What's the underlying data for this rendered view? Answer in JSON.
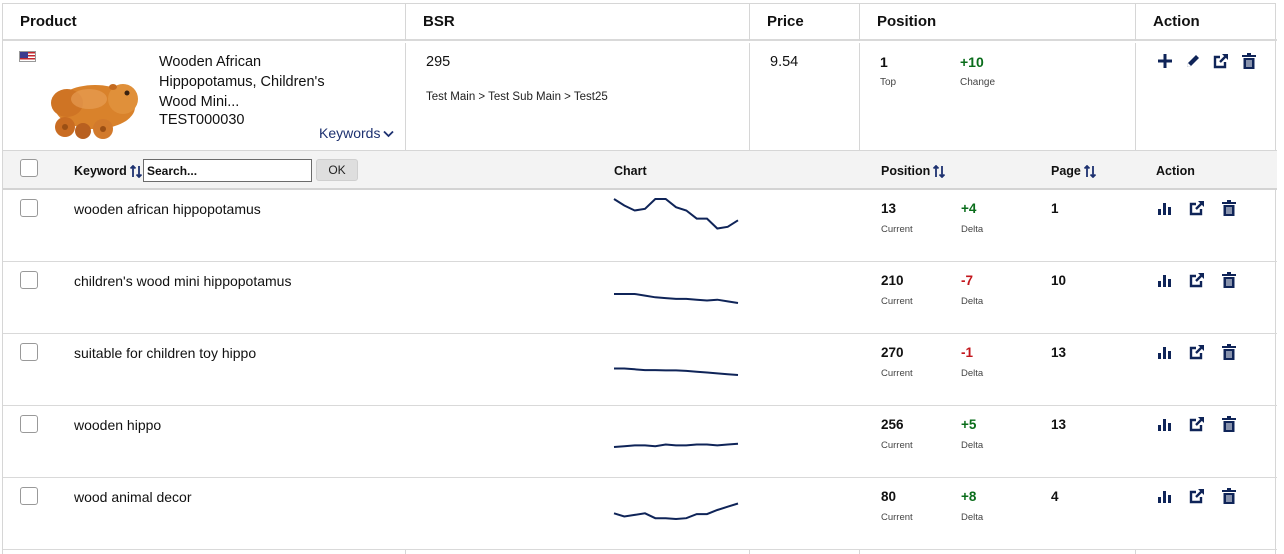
{
  "header": {
    "product": "Product",
    "bsr": "BSR",
    "price": "Price",
    "position": "Position",
    "action": "Action"
  },
  "product": {
    "flag": "us-flag-icon",
    "title": "Wooden African Hippopotamus, Children's Wood Mini...",
    "sku": "TEST000030",
    "keywords_link": "Keywords",
    "bsr": "295",
    "category_path": "Test Main > Test Sub Main > Test25",
    "price": "9.54",
    "position": {
      "value": "1",
      "label": "Top",
      "change": "+10",
      "change_label": "Change"
    },
    "actions": [
      "plus-icon",
      "pencil-icon",
      "external-link-icon",
      "trash-icon"
    ]
  },
  "keyword_table": {
    "keyword_header": "Keyword",
    "search_placeholder": "Search...",
    "ok_label": "OK",
    "chart_header": "Chart",
    "position_header": "Position",
    "page_header": "Page",
    "action_header": "Action",
    "current_label": "Current",
    "delta_label": "Delta",
    "row_actions": [
      "bar-chart-icon",
      "external-link-icon",
      "trash-icon"
    ],
    "spark_color": "#0f2458",
    "rows": [
      {
        "keyword": "wooden african hippopotamus",
        "current": "13",
        "delta": "+4",
        "delta_sign": "pos",
        "page": "1",
        "trend": [
          2,
          6,
          9,
          8,
          2,
          2,
          7,
          9,
          14,
          14,
          20,
          19,
          15
        ]
      },
      {
        "keyword": "children's wood mini hippopotamus",
        "current": "210",
        "delta": "-7",
        "delta_sign": "neg",
        "page": "10",
        "trend": [
          208,
          208,
          208,
          209,
          210,
          210.5,
          211,
          211,
          211.5,
          212,
          211.5,
          212.5,
          213.5
        ]
      },
      {
        "keyword": "suitable for children toy hippo",
        "current": "270",
        "delta": "-1",
        "delta_sign": "neg",
        "page": "13",
        "trend": [
          266,
          266,
          266.5,
          267,
          267,
          267.2,
          267.2,
          267.5,
          268,
          268.5,
          269,
          269.5,
          270
        ]
      },
      {
        "keyword": "wooden hippo",
        "current": "256",
        "delta": "+5",
        "delta_sign": "pos",
        "page": "13",
        "trend": [
          260,
          259.5,
          259,
          259,
          259.5,
          258.5,
          259,
          259,
          258.5,
          258.5,
          259,
          258.5,
          258
        ]
      },
      {
        "keyword": "wood animal decor",
        "current": "80",
        "delta": "+8",
        "delta_sign": "pos",
        "page": "4",
        "trend": [
          88,
          90,
          89,
          88,
          91,
          91,
          91.5,
          91,
          88.5,
          88.5,
          86,
          84,
          82
        ]
      }
    ]
  }
}
